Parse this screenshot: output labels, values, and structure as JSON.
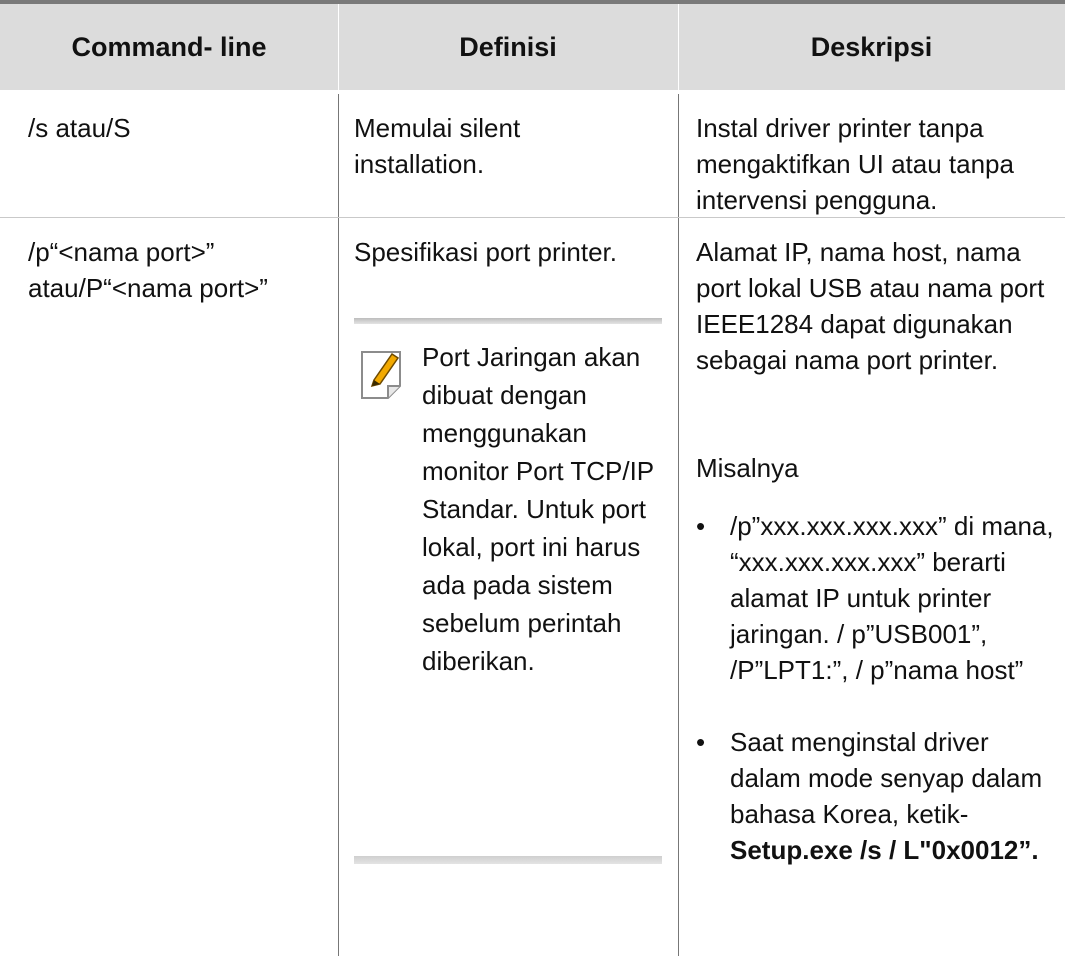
{
  "header": {
    "col1": "Command- line",
    "col2": "Definisi",
    "col3": "Deskripsi"
  },
  "rows": [
    {
      "command": "/s atau/S",
      "definition": "Memulai silent installation.",
      "description": "Instal driver printer tanpa mengaktifkan UI atau tanpa intervensi pengguna."
    },
    {
      "command": "/p“<nama port>” atau/P“<nama port>”",
      "definition": "Spesifikasi port printer.",
      "note": "Port Jaringan akan dibuat dengan menggunakan monitor Port TCP/IP Standar. Untuk port lokal, port ini harus ada pada sistem sebelum perintah diberikan.",
      "description": "Alamat IP, nama host, nama port lokal USB atau nama port IEEE1284 dapat digunakan sebagai nama port printer.",
      "example_label": "Misalnya",
      "bullets": [
        {
          "text": "/p”xxx.xxx.xxx.xxx” di mana, “xxx.xxx.xxx.xxx” berarti alamat IP untuk printer jaringan. / p”USB001”, /P”LPT1:”, / p”nama host”"
        },
        {
          "text_prefix": "Saat menginstal driver dalam mode senyap dalam bahasa Korea, ketik-",
          "text_bold": "Setup.exe /s / L\"0x0012”."
        }
      ]
    }
  ],
  "icons": {
    "note_icon": "note-pencil-icon",
    "bullet": "•"
  },
  "colors": {
    "header_bg": "#dcdcdc",
    "header_rule": "#7a7a7a",
    "row_divider": "#c9c9c9",
    "col_divider": "#777777",
    "note_icon_pencil": "#f2a900"
  }
}
